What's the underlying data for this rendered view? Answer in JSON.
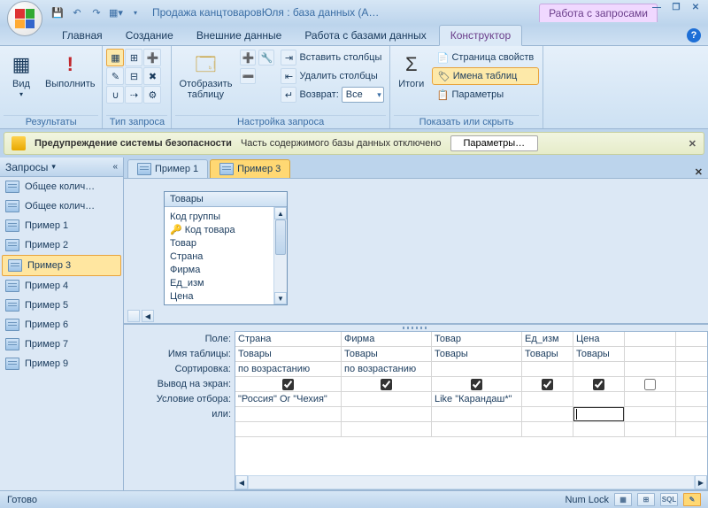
{
  "title": "Продажа канцтоваровЮля : база данных (Acces…",
  "context_tab": "Работа с запросами",
  "tabs": {
    "items": [
      "Главная",
      "Создание",
      "Внешние данные",
      "Работа с базами данных",
      "Конструктор"
    ],
    "active": "Конструктор"
  },
  "ribbon": {
    "groups": {
      "results": {
        "label": "Результаты",
        "view": "Вид",
        "run": "Выполнить"
      },
      "query_type": {
        "label": "Тип запроса"
      },
      "setup": {
        "label": "Настройка запроса",
        "show_table": "Отобразить\nтаблицу",
        "insert_cols": "Вставить столбцы",
        "delete_cols": "Удалить столбцы",
        "return_label": "Возврат:",
        "return_value": "Все"
      },
      "show_hide": {
        "label": "Показать или скрыть",
        "totals": "Итоги",
        "prop_page": "Страница свойств",
        "table_names": "Имена таблиц",
        "params": "Параметры"
      }
    }
  },
  "security": {
    "title": "Предупреждение системы безопасности",
    "msg": "Часть содержимого базы данных отключено",
    "btn": "Параметры…"
  },
  "nav": {
    "header": "Запросы",
    "items": [
      "Общее колич…",
      "Общее колич…",
      "Пример 1",
      "Пример 2",
      "Пример 3",
      "Пример 4",
      "Пример 5",
      "Пример 6",
      "Пример 7",
      "Пример 9"
    ],
    "selected": "Пример 3"
  },
  "doc_tabs": {
    "items": [
      "Пример 1",
      "Пример 3"
    ],
    "active": "Пример 3"
  },
  "table_window": {
    "title": "Товары",
    "key_field": "Код товара",
    "fields": [
      "Код группы",
      "Код товара",
      "Товар",
      "Страна",
      "Фирма",
      "Ед_изм",
      "Цена"
    ]
  },
  "design_grid": {
    "row_labels": [
      "Поле:",
      "Имя таблицы:",
      "Сортировка:",
      "Вывод на экран:",
      "Условие отбора:",
      "или:"
    ],
    "columns": [
      {
        "field": "Страна",
        "table": "Товары",
        "sort": "по возрастанию",
        "show": true,
        "criteria": "\"Россия\" Or \"Чехия\""
      },
      {
        "field": "Фирма",
        "table": "Товары",
        "sort": "по возрастанию",
        "show": true,
        "criteria": ""
      },
      {
        "field": "Товар",
        "table": "Товары",
        "sort": "",
        "show": true,
        "criteria": "Like \"Карандаш*\""
      },
      {
        "field": "Ед_изм",
        "table": "Товары",
        "sort": "",
        "show": true,
        "criteria": ""
      },
      {
        "field": "Цена",
        "table": "Товары",
        "sort": "",
        "show": true,
        "criteria": ""
      },
      {
        "field": "",
        "table": "",
        "sort": "",
        "show": false,
        "criteria": ""
      }
    ]
  },
  "status": {
    "ready": "Готово",
    "numlock": "Num Lock"
  }
}
